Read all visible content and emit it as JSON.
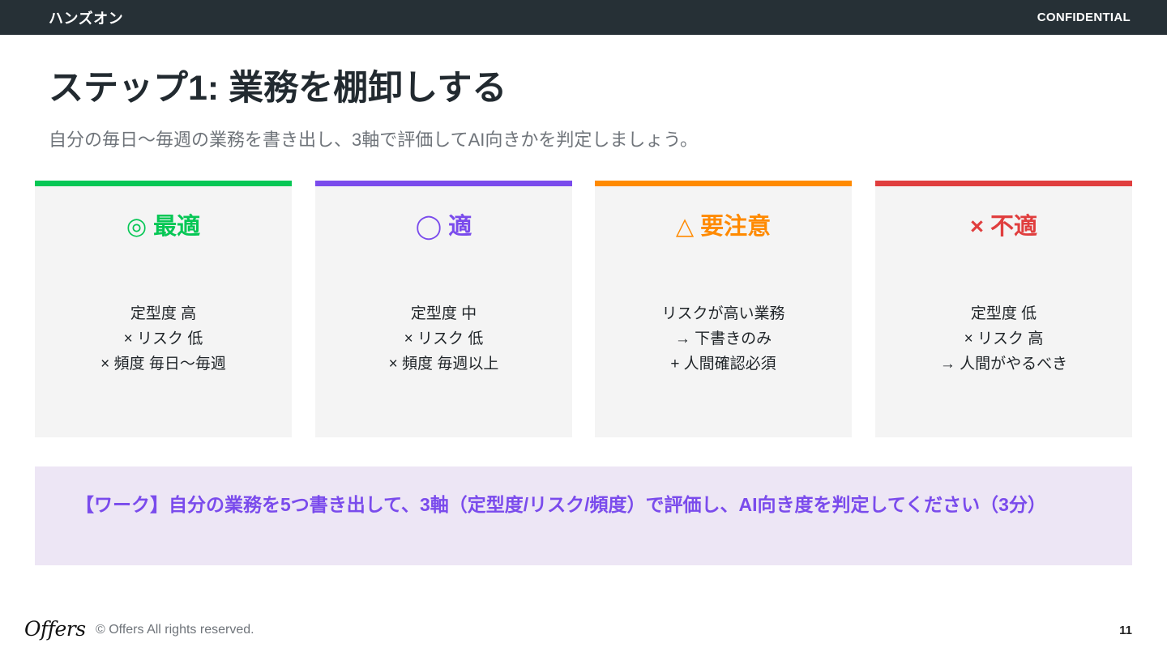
{
  "header": {
    "section": "ハンズオン",
    "confidential": "CONFIDENTIAL"
  },
  "title": "ステップ1: 業務を棚卸しする",
  "subtitle": "自分の毎日〜毎週の業務を書き出し、3軸で評価してAI向きかを判定しましょう。",
  "cards": [
    {
      "heading": "◎ 最適",
      "color": "#06c755",
      "lines": [
        "定型度 高",
        "× リスク 低",
        "× 頻度 毎日〜毎週"
      ]
    },
    {
      "heading": "◯ 適",
      "color": "#7a4bec",
      "lines": [
        "定型度 中",
        "× リスク 低",
        "× 頻度 毎週以上"
      ]
    },
    {
      "heading": "△ 要注意",
      "color": "#ff8a00",
      "lines": [
        "リスクが高い業務",
        "→ 下書きのみ",
        "+ 人間確認必須"
      ]
    },
    {
      "heading": "× 不適",
      "color": "#e03e3e",
      "lines": [
        "定型度 低",
        "× リスク 高",
        "→ 人間がやるべき"
      ]
    }
  ],
  "work_note": "【ワーク】自分の業務を5つ書き出して、3軸（定型度/リスク/頻度）で評価し、AI向き度を判定してください（3分）",
  "footer": {
    "logo": "Offers",
    "copyright": "© Offers All rights reserved.",
    "page": "11"
  }
}
